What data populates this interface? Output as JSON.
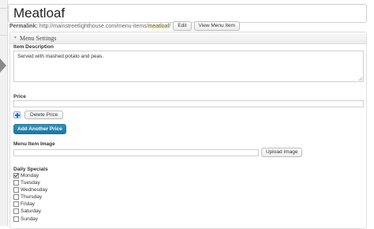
{
  "post": {
    "title": "Meatloaf",
    "permalink_label": "Permalink:",
    "permalink_base": "http://mainstreetlighthouse.com/menu-items/",
    "permalink_slug": "meatloaf",
    "permalink_trailing": "/",
    "edit_label": "Edit",
    "view_label": "View Menu Item"
  },
  "menu_settings": {
    "box_title": "Menu Settings",
    "description_label": "Item Description",
    "description_value": "Served with mashed potato and peas.",
    "price_label": "Price",
    "price_value": "",
    "delete_price_label": "Delete Price",
    "add_price_label": "Add Another Price",
    "image_label": "Menu Item Image",
    "image_value": "",
    "upload_label": "Upload Image",
    "specials_label": "Daily Specials",
    "days": [
      {
        "label": "Monday",
        "checked": true
      },
      {
        "label": "Tuesday",
        "checked": false
      },
      {
        "label": "Wednesday",
        "checked": false
      },
      {
        "label": "Thursday",
        "checked": false
      },
      {
        "label": "Friday",
        "checked": false
      },
      {
        "label": "Saturday",
        "checked": false
      },
      {
        "label": "Sunday",
        "checked": false
      }
    ]
  },
  "icons": {
    "add_price": "plus-icon",
    "collapse": "triangle-down-icon",
    "sidebar_toggle": "caret-right-icon"
  },
  "colors": {
    "primary_button": "#21759b",
    "slug_highlight": "#fffbcc"
  }
}
